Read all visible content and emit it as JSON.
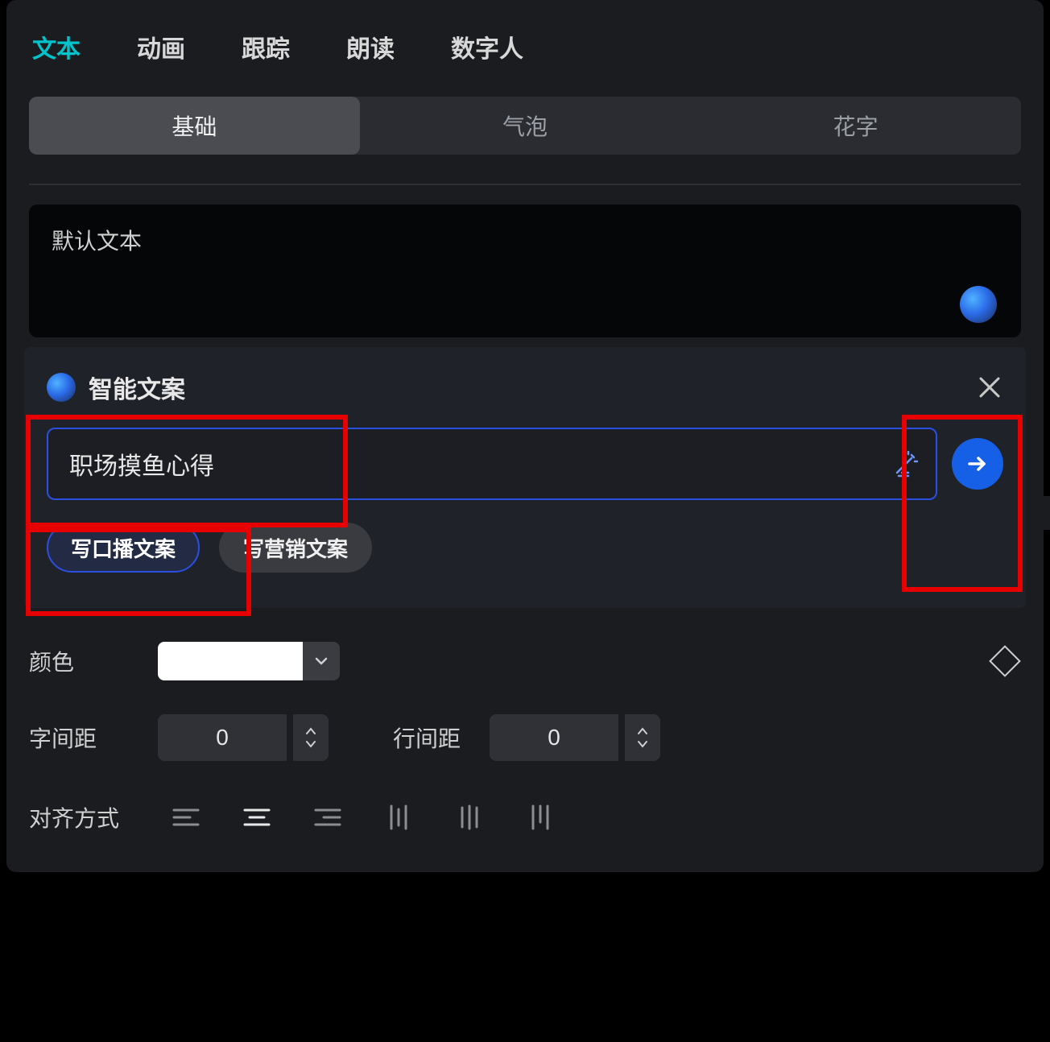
{
  "tabs": {
    "text": "文本",
    "animation": "动画",
    "tracking": "跟踪",
    "readAloud": "朗读",
    "digitalHuman": "数字人"
  },
  "subtabs": {
    "basic": "基础",
    "bubble": "气泡",
    "styled": "花字"
  },
  "textBox": {
    "default": "默认文本"
  },
  "ai": {
    "title": "智能文案",
    "inputValue": "职场摸鱼心得",
    "chipBroadcast": "写口播文案",
    "chipMarketing": "写营销文案"
  },
  "props": {
    "colorLabel": "颜色",
    "colorValue": "#FFFFFF",
    "letterSpacingLabel": "字间距",
    "letterSpacingValue": "0",
    "lineSpacingLabel": "行间距",
    "lineSpacingValue": "0",
    "alignLabel": "对齐方式"
  }
}
